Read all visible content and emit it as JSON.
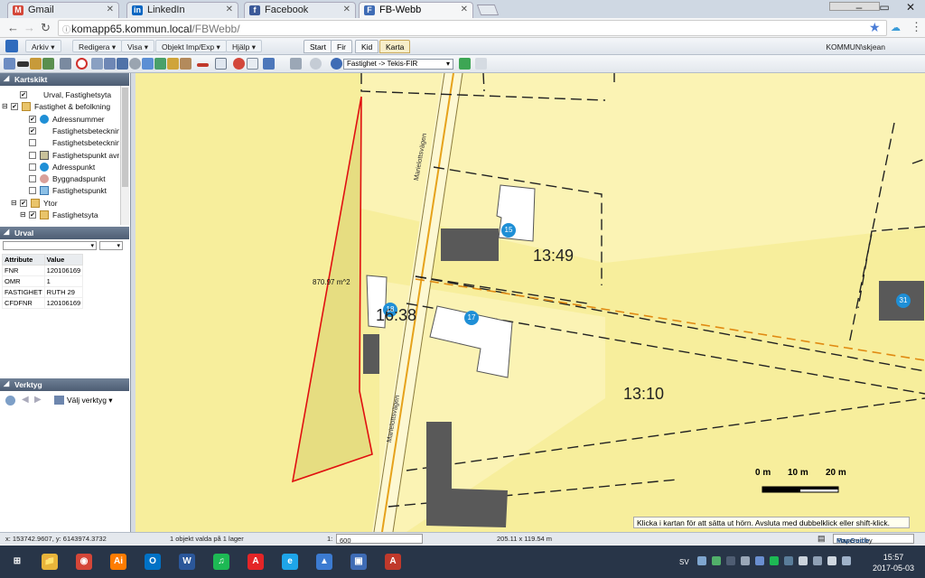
{
  "browser": {
    "tabs": [
      {
        "label": "Gmail",
        "icon": "gmail-icon",
        "color": "#d44638"
      },
      {
        "label": "LinkedIn",
        "icon": "linkedin-icon",
        "color": "#0a66c2"
      },
      {
        "label": "Facebook",
        "icon": "facebook-icon",
        "color": "#3b5998"
      },
      {
        "label": "FB-Webb",
        "icon": "fbwebb-icon",
        "color": "#3f6cb5"
      }
    ],
    "url_host": "komapp65.kommun.local",
    "url_path": "/FBWebb/"
  },
  "app": {
    "menus": [
      "Arkiv",
      "Redigera",
      "Visa",
      "Objekt Imp/Exp",
      "Hjälp"
    ],
    "map_tabs": [
      "Start",
      "Fir",
      "Kid",
      "Karta"
    ],
    "user": "KOMMUN\\skjean",
    "layer_select": "Fastighet -> Tekis-FIR"
  },
  "left": {
    "kartskikt_title": "Kartskikt",
    "layers": [
      {
        "label": "Urval, Fastighetsyta",
        "checked": true,
        "sym": "none",
        "indent": 1
      },
      {
        "label": "Fastighet & befolkning",
        "checked": true,
        "sym": "folder",
        "indent": 0
      },
      {
        "label": "Adressnummer",
        "checked": true,
        "sym": "dot-blue",
        "indent": 2
      },
      {
        "label": "Fastighetsbeteckningsi",
        "checked": true,
        "sym": "none",
        "indent": 2
      },
      {
        "label": "Fastighetsbeteckning",
        "checked": false,
        "sym": "none",
        "indent": 2
      },
      {
        "label": "Fastighetspunkt avregi",
        "checked": false,
        "sym": "box-gray",
        "indent": 2
      },
      {
        "label": "Adresspunkt",
        "checked": false,
        "sym": "dot-blue",
        "indent": 2
      },
      {
        "label": "Byggnadspunkt",
        "checked": false,
        "sym": "dot-pink",
        "indent": 2
      },
      {
        "label": "Fastighetspunkt",
        "checked": false,
        "sym": "box-blue",
        "indent": 2
      },
      {
        "label": "Ytor",
        "checked": true,
        "sym": "folder",
        "indent": 1
      },
      {
        "label": "Fastighetsyta",
        "checked": true,
        "sym": "folder",
        "indent": 2
      }
    ],
    "urval_title": "Urval",
    "attr_headers": [
      "Attribute",
      "Value"
    ],
    "attrs": [
      [
        "FNR",
        "120106169"
      ],
      [
        "OMR",
        "1"
      ],
      [
        "FASTIGHET",
        "RUTH 29"
      ],
      [
        "CFDFNR",
        "120106169"
      ]
    ],
    "verktyg_title": "Verktyg",
    "verktyg_label": "Välj verktyg"
  },
  "map": {
    "parcels": [
      "13:49",
      "16:38",
      "13:10"
    ],
    "address_numbers": [
      "15",
      "17",
      "18",
      "31"
    ],
    "street_names": [
      "Marielottsvägen",
      "Marielottsvägen"
    ],
    "area_label": "870.97 m^2",
    "scale_labels": [
      "0 m",
      "10 m",
      "20 m"
    ],
    "hint": "Klicka i kartan för att sätta ut hörn. Avsluta med dubbelklick eller shift-klick.",
    "colors": {
      "base": "#f7ee9c",
      "parcel": "#fbf3b4",
      "green": "#e6dd82",
      "building": "#555555",
      "selection": "#ff0000"
    }
  },
  "status": {
    "coords": "x: 153742.9607, y: 6143974.3732",
    "selection": "1 objekt valda på 1 lager",
    "scale_prefix": "1:",
    "scale": "600",
    "extent": "205.11 x 119.54 m",
    "powered_by": "Powered by",
    "mapguide": "MapGuide"
  },
  "taskbar": {
    "apps": [
      {
        "name": "file-explorer-icon",
        "glyph": "📁",
        "color": "#e8b53a"
      },
      {
        "name": "chrome-icon",
        "glyph": "◉",
        "color": "#d44638"
      },
      {
        "name": "illustrator-icon",
        "glyph": "Ai",
        "color": "#ff7c00"
      },
      {
        "name": "outlook-icon",
        "glyph": "O",
        "color": "#0072c6"
      },
      {
        "name": "word-icon",
        "glyph": "W",
        "color": "#2b579a"
      },
      {
        "name": "spotify-icon",
        "glyph": "♫",
        "color": "#1db954"
      },
      {
        "name": "acrobat-icon",
        "glyph": "A",
        "color": "#e42527"
      },
      {
        "name": "ie-icon",
        "glyph": "e",
        "color": "#1ea5e9"
      },
      {
        "name": "arcgis-icon",
        "glyph": "▲",
        "color": "#3c7bd1"
      },
      {
        "name": "photos-icon",
        "glyph": "▣",
        "color": "#3f6cb5"
      },
      {
        "name": "pdf-icon",
        "glyph": "A",
        "color": "#c0392b"
      }
    ],
    "lang": "SV",
    "time": "15:57",
    "date": "2017-05-03"
  }
}
